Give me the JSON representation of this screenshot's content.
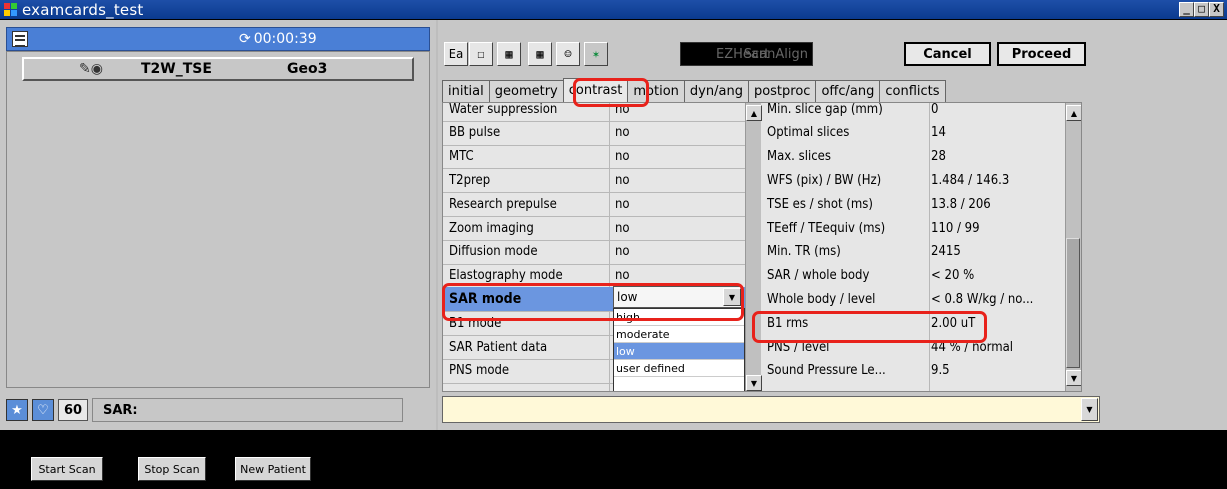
{
  "window": {
    "title": "examcards_test",
    "controls": [
      "_",
      "□",
      "X"
    ]
  },
  "left": {
    "timer": "00:00:39",
    "scan": {
      "name": "T2W_TSE",
      "geo": "Geo3"
    },
    "sar_value": "60",
    "sar_label": "SAR:"
  },
  "toolbar": {
    "icon_buttons": [
      "Ea",
      "☐",
      "▦",
      "▦",
      "☺",
      "✶"
    ],
    "ezheart": "EZHeart",
    "scanalign": "ScanAlign",
    "cancel": "Cancel",
    "proceed": "Proceed"
  },
  "tabs": [
    {
      "label": "initial"
    },
    {
      "label": "geometry"
    },
    {
      "label": "contrast"
    },
    {
      "label": "motion"
    },
    {
      "label": "dyn/ang"
    },
    {
      "label": "postproc"
    },
    {
      "label": "offc/ang"
    },
    {
      "label": "conflicts"
    }
  ],
  "params_left": [
    {
      "label": "Water suppression",
      "value": "no"
    },
    {
      "label": "BB pulse",
      "value": "no"
    },
    {
      "label": "MTC",
      "value": "no"
    },
    {
      "label": "T2prep",
      "value": "no"
    },
    {
      "label": "Research prepulse",
      "value": "no"
    },
    {
      "label": "Zoom imaging",
      "value": "no"
    },
    {
      "label": "Diffusion mode",
      "value": "no"
    },
    {
      "label": "Elastography mode",
      "value": "no"
    },
    {
      "label": "SAR mode",
      "value": "low"
    },
    {
      "label": "B1 mode",
      "value": ""
    },
    {
      "label": "SAR Patient data",
      "value": ""
    },
    {
      "label": "PNS mode",
      "value": ""
    }
  ],
  "sar_options": [
    "high",
    "moderate",
    "low",
    "user defined"
  ],
  "params_right": [
    {
      "label": "Min. slice gap (mm)",
      "value": "0"
    },
    {
      "label": "Optimal slices",
      "value": "14"
    },
    {
      "label": "Max. slices",
      "value": "28"
    },
    {
      "label": "WFS (pix) / BW (Hz)",
      "value": "1.484 / 146.3"
    },
    {
      "label": "TSE es / shot (ms)",
      "value": "13.8 / 206"
    },
    {
      "label": "TEeff / TEequiv (ms)",
      "value": "110 / 99"
    },
    {
      "label": "Min. TR (ms)",
      "value": "2415"
    },
    {
      "label": "SAR / whole body",
      "value": "< 20 %"
    },
    {
      "label": "Whole body / level",
      "value": "< 0.8 W/kg / no..."
    },
    {
      "label": "B1 rms",
      "value": "2.00 uT"
    },
    {
      "label": "PNS / level",
      "value": "44 % / normal"
    },
    {
      "label": "Sound Pressure Le...",
      "value": "9.5"
    }
  ],
  "bottom_buttons": [
    {
      "label": "Start Scan"
    },
    {
      "label": "Stop Scan"
    },
    {
      "label": "New Patient"
    }
  ],
  "colors": {
    "title_bar": "#0b3a8e",
    "accent_blue": "#4a7fd6",
    "highlight_red": "#e8221b",
    "input_yellow": "#fff9d8"
  }
}
